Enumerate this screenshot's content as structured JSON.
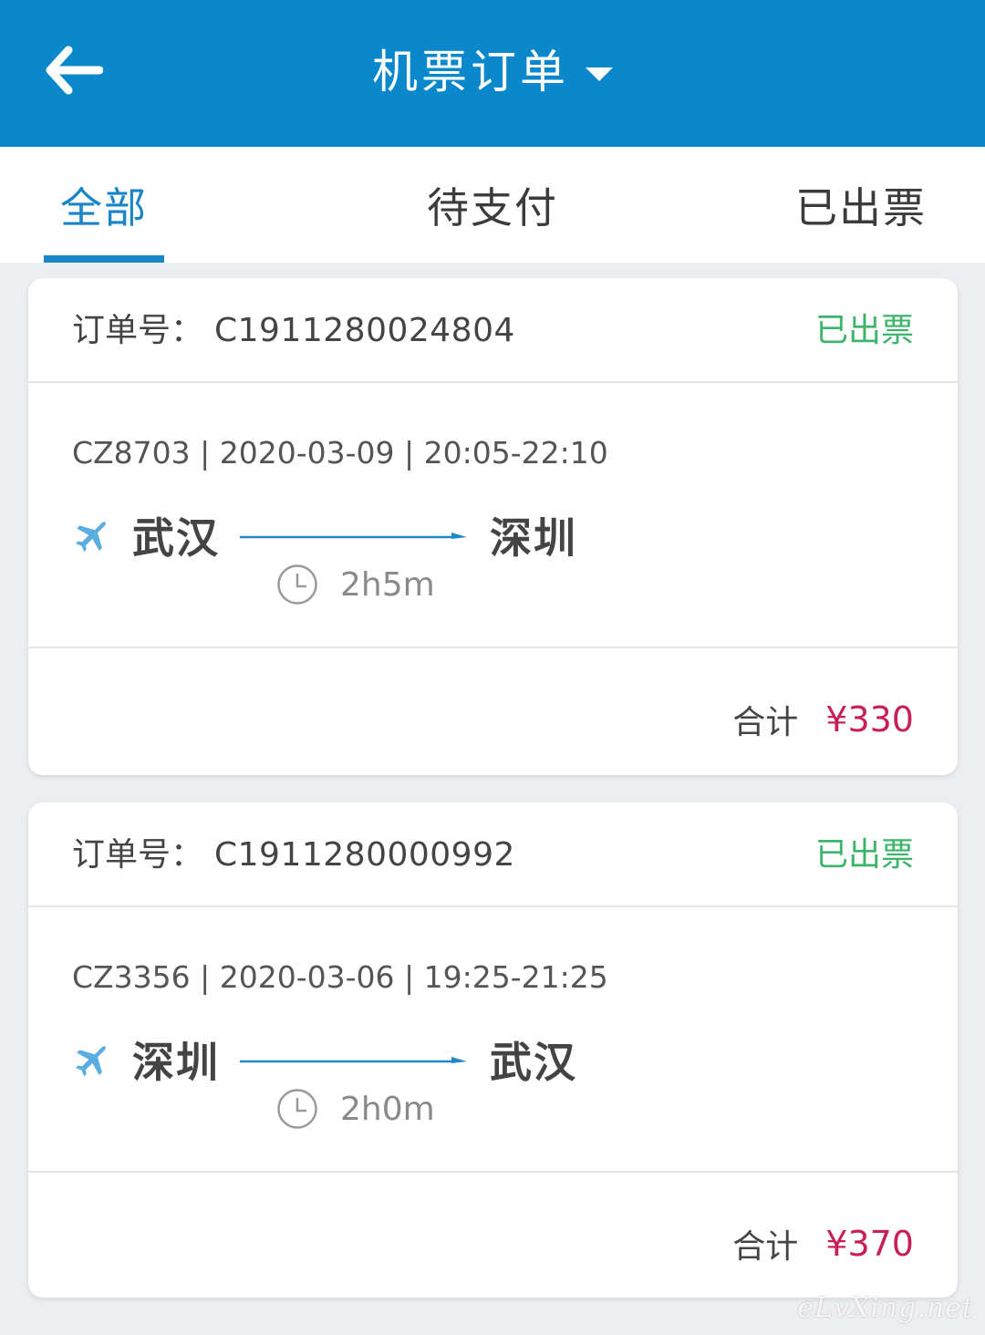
{
  "header": {
    "title": "机票订单",
    "back_icon": "back-arrow-icon",
    "dropdown_icon": "caret-down-icon",
    "bg_color": "#0a88cb"
  },
  "tabs": [
    {
      "label": "全部",
      "active": true
    },
    {
      "label": "待支付",
      "active": false
    },
    {
      "label": "已出票",
      "active": false
    }
  ],
  "orders": [
    {
      "order_label": "订单号：",
      "order_no": "C1911280024804",
      "status": "已出票",
      "flight_info": "CZ8703 | 2020-03-09 | 20:05-22:10",
      "from": "武汉",
      "to": "深圳",
      "duration": "2h5m",
      "total_label": "合计",
      "price": "¥330"
    },
    {
      "order_label": "订单号：",
      "order_no": "C1911280000992",
      "status": "已出票",
      "flight_info": "CZ3356 | 2020-03-06 | 19:25-21:25",
      "from": "深圳",
      "to": "武汉",
      "duration": "2h0m",
      "total_label": "合计",
      "price": "¥370"
    }
  ],
  "watermark": "eLvXing.net",
  "colors": {
    "accent": "#1a85c6",
    "status_green": "#3cb56a",
    "price_red": "#c81f5b",
    "plane_blue": "#5aaee0"
  }
}
